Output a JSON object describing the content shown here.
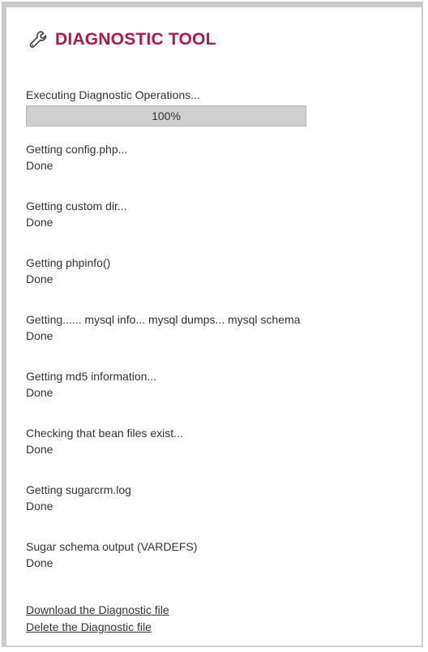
{
  "header": {
    "icon": "wrench-icon",
    "title": "DIAGNOSTIC TOOL",
    "title_color": "#b1174b"
  },
  "execution": {
    "label": "Executing Diagnostic Operations...",
    "progress_text": "100%",
    "progress_fraction": 1.0
  },
  "steps": [
    {
      "label": "Getting config.php...",
      "status": "Done"
    },
    {
      "label": "Getting custom dir...",
      "status": "Done"
    },
    {
      "label": "Getting phpinfo()",
      "status": "Done"
    },
    {
      "label": "Getting...... mysql info... mysql dumps... mysql schema",
      "status": "Done"
    },
    {
      "label": "Getting md5 information...",
      "status": "Done"
    },
    {
      "label": "Checking that bean files exist...",
      "status": "Done"
    },
    {
      "label": "Getting sugarcrm.log",
      "status": "Done"
    },
    {
      "label": "Sugar schema output (VARDEFS)",
      "status": "Done"
    }
  ],
  "links": {
    "download": "Download the Diagnostic file",
    "delete": "Delete the Diagnostic file"
  }
}
